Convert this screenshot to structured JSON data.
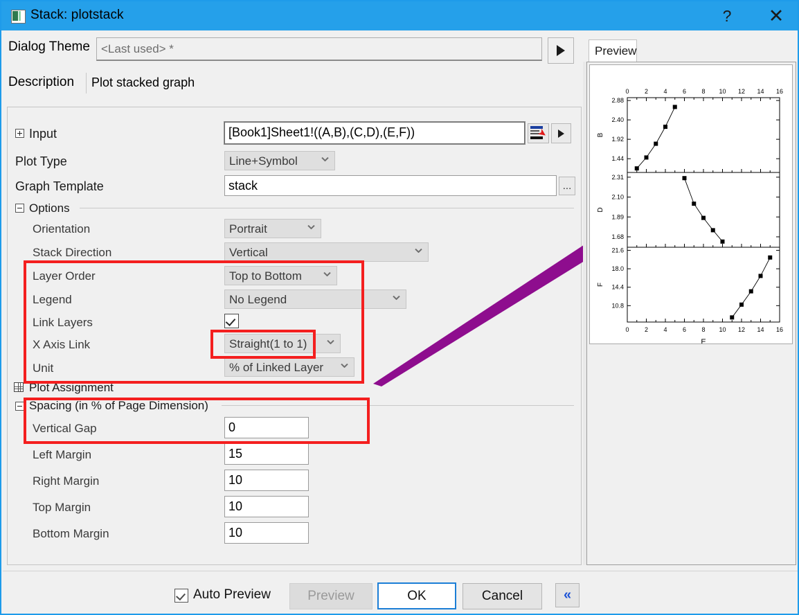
{
  "window": {
    "title": "Stack: plotstack",
    "icon": "stack-graph-icon",
    "help_label": "?",
    "close_label": "✕"
  },
  "theme": {
    "label": "Dialog Theme",
    "value": "<Last used> *",
    "arrow_label": "▶"
  },
  "description": {
    "label": "Description",
    "value": "Plot stacked graph"
  },
  "form": {
    "input": {
      "label": "Input",
      "value": "[Book1]Sheet1!((A,B),(C,D),(E,F))",
      "selector_icon": "data-selector-icon",
      "arrow_label": "▶"
    },
    "plot_type": {
      "label": "Plot Type",
      "value": "Line+Symbol"
    },
    "graph_template": {
      "label": "Graph Template",
      "value": "stack",
      "browse_label": "..."
    },
    "options_group": "Options",
    "orientation": {
      "label": "Orientation",
      "value": "Portrait"
    },
    "stack_direction": {
      "label": "Stack Direction",
      "value": "Vertical"
    },
    "layer_order": {
      "label": "Layer Order",
      "value": "Top to Bottom"
    },
    "legend": {
      "label": "Legend",
      "value": "No Legend"
    },
    "link_layers": {
      "label": "Link Layers",
      "checked": true
    },
    "x_axis_link": {
      "label": "X Axis Link",
      "value": "Straight(1 to 1)"
    },
    "unit": {
      "label": "Unit",
      "value": "% of Linked Layer"
    },
    "plot_assignment_group": "Plot Assignment",
    "spacing_group": "Spacing (in % of Page Dimension)",
    "vertical_gap": {
      "label": "Vertical Gap",
      "value": "0"
    },
    "left_margin": {
      "label": "Left Margin",
      "value": "15"
    },
    "right_margin": {
      "label": "Right Margin",
      "value": "10"
    },
    "top_margin": {
      "label": "Top Margin",
      "value": "10"
    },
    "bottom_margin": {
      "label": "Bottom Margin",
      "value": "10"
    }
  },
  "preview": {
    "tab_label": "Preview"
  },
  "footer": {
    "auto_preview_label": "Auto Preview",
    "auto_preview_checked": true,
    "preview_label": "Preview",
    "ok_label": "OK",
    "cancel_label": "Cancel",
    "collapse_label": "«"
  },
  "colors": {
    "titlebar": "#25a0ea",
    "accent": "#1b7ed6",
    "highlight_box": "#f41f1f",
    "annotation_arrow": "#8e0d8e",
    "panel_bg": "#f0f0f0"
  },
  "chart_data": [
    {
      "type": "scatter",
      "title": "",
      "xlabel": "",
      "ylabel": "B",
      "x": [
        1,
        2,
        3,
        4,
        5
      ],
      "values": [
        1.2,
        1.47,
        1.81,
        2.23,
        2.72
      ],
      "xlim": [
        0,
        16
      ],
      "ylim": [
        1.1,
        2.95
      ],
      "xticks": [
        0,
        2,
        4,
        6,
        8,
        10,
        12,
        14,
        16
      ],
      "yticks": [
        1.44,
        1.92,
        2.4,
        2.88
      ],
      "grid": false,
      "legend": "none",
      "marker": "filled-square",
      "line": "solid"
    },
    {
      "type": "scatter",
      "title": "",
      "xlabel": "",
      "ylabel": "D",
      "x": [
        6,
        7,
        8,
        9,
        10
      ],
      "values": [
        2.3,
        2.03,
        1.88,
        1.75,
        1.63
      ],
      "xlim": [
        0,
        16
      ],
      "ylim": [
        1.57,
        2.36
      ],
      "xticks": [
        0,
        2,
        4,
        6,
        8,
        10,
        12,
        14,
        16
      ],
      "yticks": [
        1.68,
        1.89,
        2.1,
        2.31
      ],
      "grid": false,
      "legend": "none",
      "marker": "filled-square",
      "line": "solid"
    },
    {
      "type": "scatter",
      "title": "",
      "xlabel": "E",
      "ylabel": "F",
      "x": [
        11,
        12,
        13,
        14,
        15
      ],
      "values": [
        8.5,
        11.0,
        13.6,
        16.6,
        20.2
      ],
      "xlim": [
        0,
        16
      ],
      "ylim": [
        7.6,
        22.2
      ],
      "xticks": [
        0,
        2,
        4,
        6,
        8,
        10,
        12,
        14,
        16
      ],
      "yticks": [
        10.8,
        14.4,
        18.0,
        21.6
      ],
      "grid": false,
      "legend": "none",
      "marker": "filled-square",
      "line": "solid"
    }
  ]
}
